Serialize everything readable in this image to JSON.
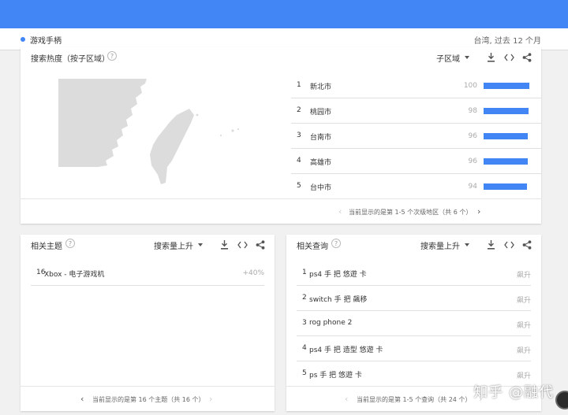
{
  "header": {
    "term": "游戏手柄",
    "scope": "台湾, 过去 12 个月"
  },
  "region_card": {
    "title": "搜索热度（按子区域）",
    "dropdown": "子区域",
    "rows": [
      {
        "rank": "1",
        "name": "新北市",
        "value": 100
      },
      {
        "rank": "2",
        "name": "桃园市",
        "value": 98
      },
      {
        "rank": "3",
        "name": "台南市",
        "value": 96
      },
      {
        "rank": "4",
        "name": "高雄市",
        "value": 96
      },
      {
        "rank": "5",
        "name": "台中市",
        "value": 94
      }
    ],
    "pagination": "当前显示的是第 1-5 个次级地区（共 6 个）"
  },
  "topics_card": {
    "title": "相关主题",
    "dropdown": "搜索量上升",
    "rows": [
      {
        "rank": "16",
        "name": "Xbox - 电子游戏机",
        "value": "+40%"
      }
    ],
    "pagination": "当前显示的是第 16 个主题（共 16 个）"
  },
  "queries_card": {
    "title": "相关查询",
    "dropdown": "搜索量上升",
    "rows": [
      {
        "rank": "1",
        "name": "ps4 手 把 悠遊 卡",
        "value": "飙升"
      },
      {
        "rank": "2",
        "name": "switch 手 把 飆移",
        "value": "飙升"
      },
      {
        "rank": "3",
        "name": "rog phone 2",
        "value": "飙升"
      },
      {
        "rank": "4",
        "name": "ps4 手 把 造型 悠遊 卡",
        "value": "飙升"
      },
      {
        "rank": "5",
        "name": "ps 手 把 悠遊 卡",
        "value": "飙升"
      }
    ],
    "pagination": "当前显示的是第 1-5 个查询（共 24 个）"
  },
  "icons": {
    "help": "?",
    "prev": "‹",
    "next": "›"
  },
  "watermark": "知乎 @融代",
  "colors": {
    "accent": "#4285f4",
    "map_land": "#dcdcdc"
  }
}
